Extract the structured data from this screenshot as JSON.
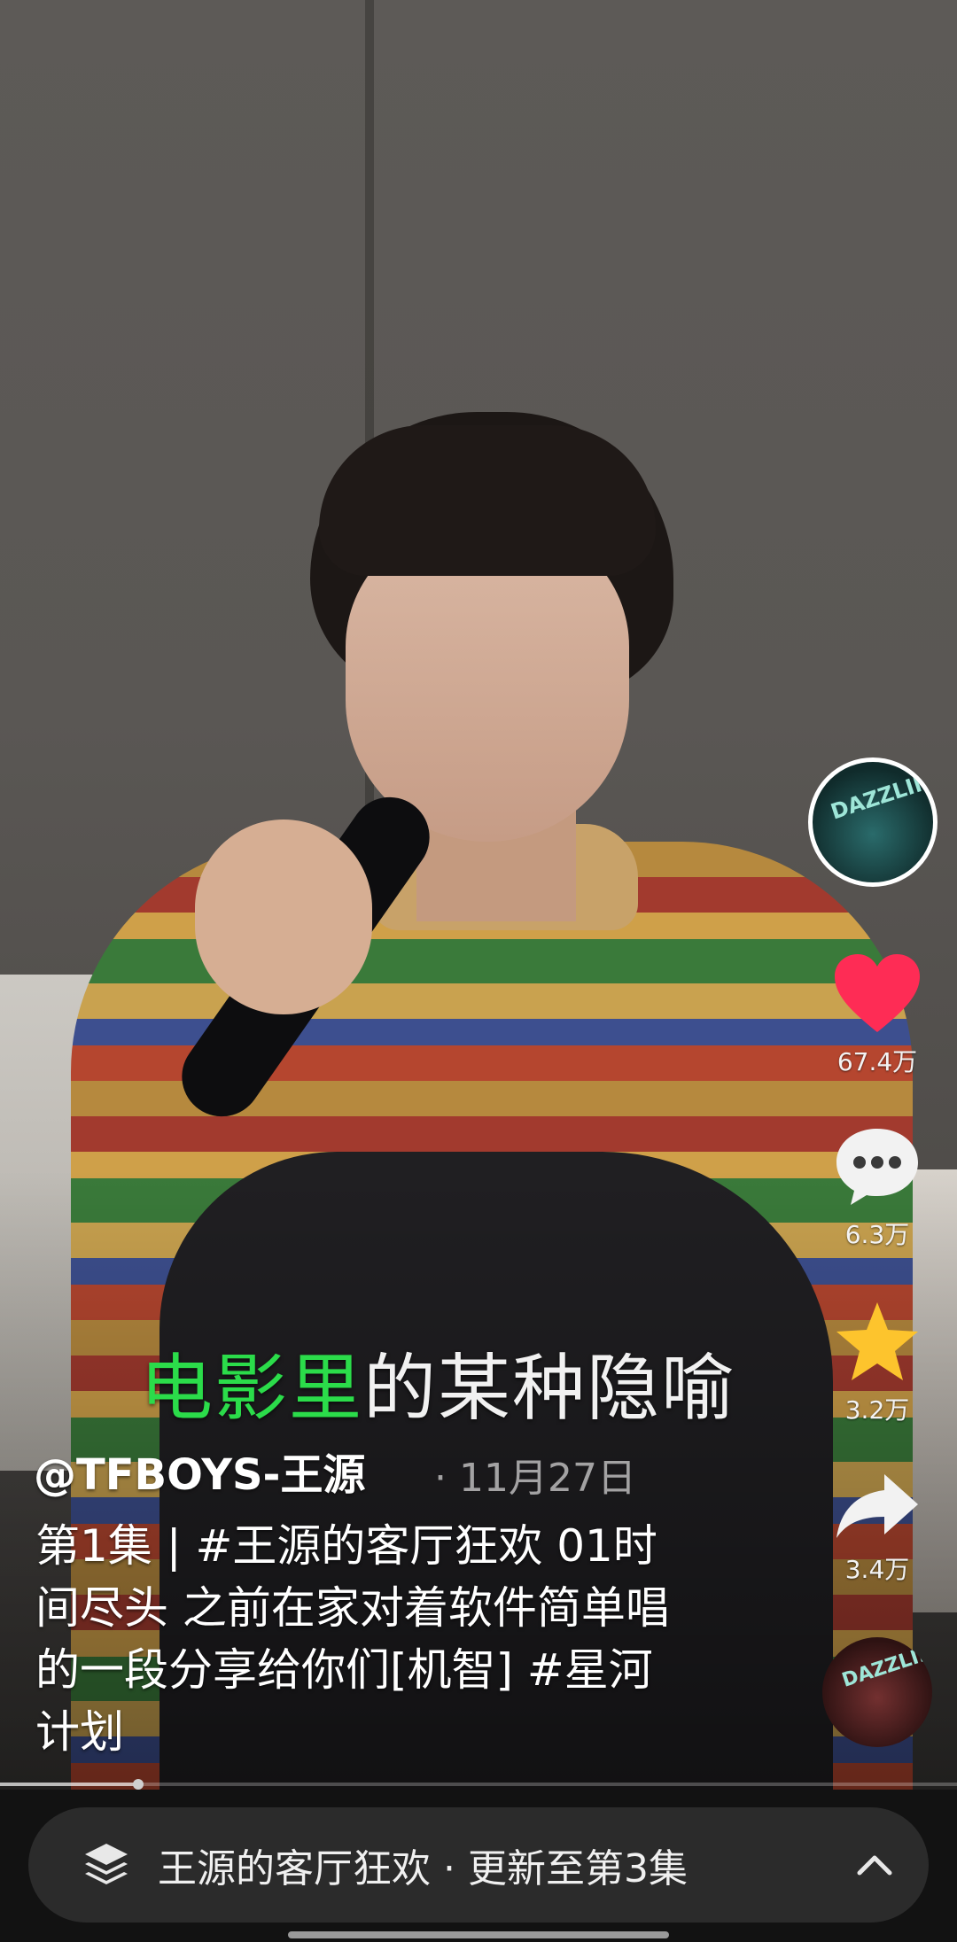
{
  "video": {
    "lyric_sung": "电影里",
    "lyric_rest": "的某种隐喻"
  },
  "actions": {
    "like_count": "67.4万",
    "comment_count": "6.3万",
    "favorite_count": "3.2万",
    "share_count": "3.4万",
    "avatar_text": "DAZZLING",
    "music_text": "DAZZLING"
  },
  "post": {
    "author": "@TFBOYS-王源",
    "date": "· 11月27日",
    "description": "第1集 | #王源的客厅狂欢 01时间尽头 之前在家对着软件简单唱的一段分享给你们[机智] #星河计划"
  },
  "progress": {
    "fraction": 0.14
  },
  "collection": {
    "label": "王源的客厅狂欢 · 更新至第3集"
  },
  "colors": {
    "like": "#fe2c55",
    "favorite": "#fdc42d",
    "lyric_highlight": "#2bdc4a"
  }
}
